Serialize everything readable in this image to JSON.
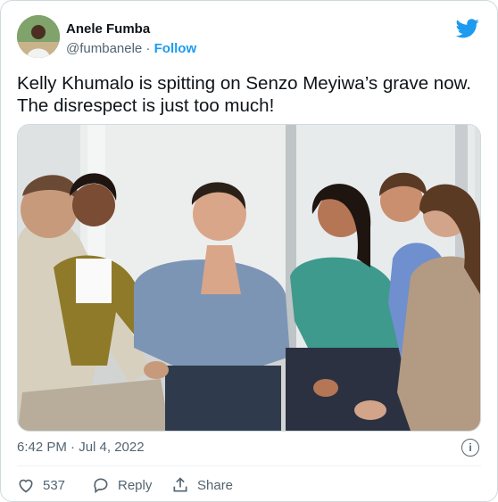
{
  "author": {
    "name": "Anele Fumba",
    "handle": "@fumbanele",
    "separator": "·",
    "follow_label": "Follow"
  },
  "tweet": {
    "text_line1": "Kelly Khumalo is spitting on Senzo Meyiwa’s grave now.",
    "text_line2": "The disrespect is just too much!",
    "timestamp": "6:42 PM · Jul 4, 2022",
    "info_symbol": "i"
  },
  "actions": {
    "likes_count": "537",
    "reply_label": "Reply",
    "share_label": "Share"
  },
  "colors": {
    "accent": "#1d9bf0",
    "text": "#0f1419",
    "muted": "#536471",
    "border": "#cfd9de"
  },
  "icons": [
    "twitter-bird-icon",
    "info-icon",
    "heart-icon",
    "reply-icon",
    "share-icon"
  ]
}
